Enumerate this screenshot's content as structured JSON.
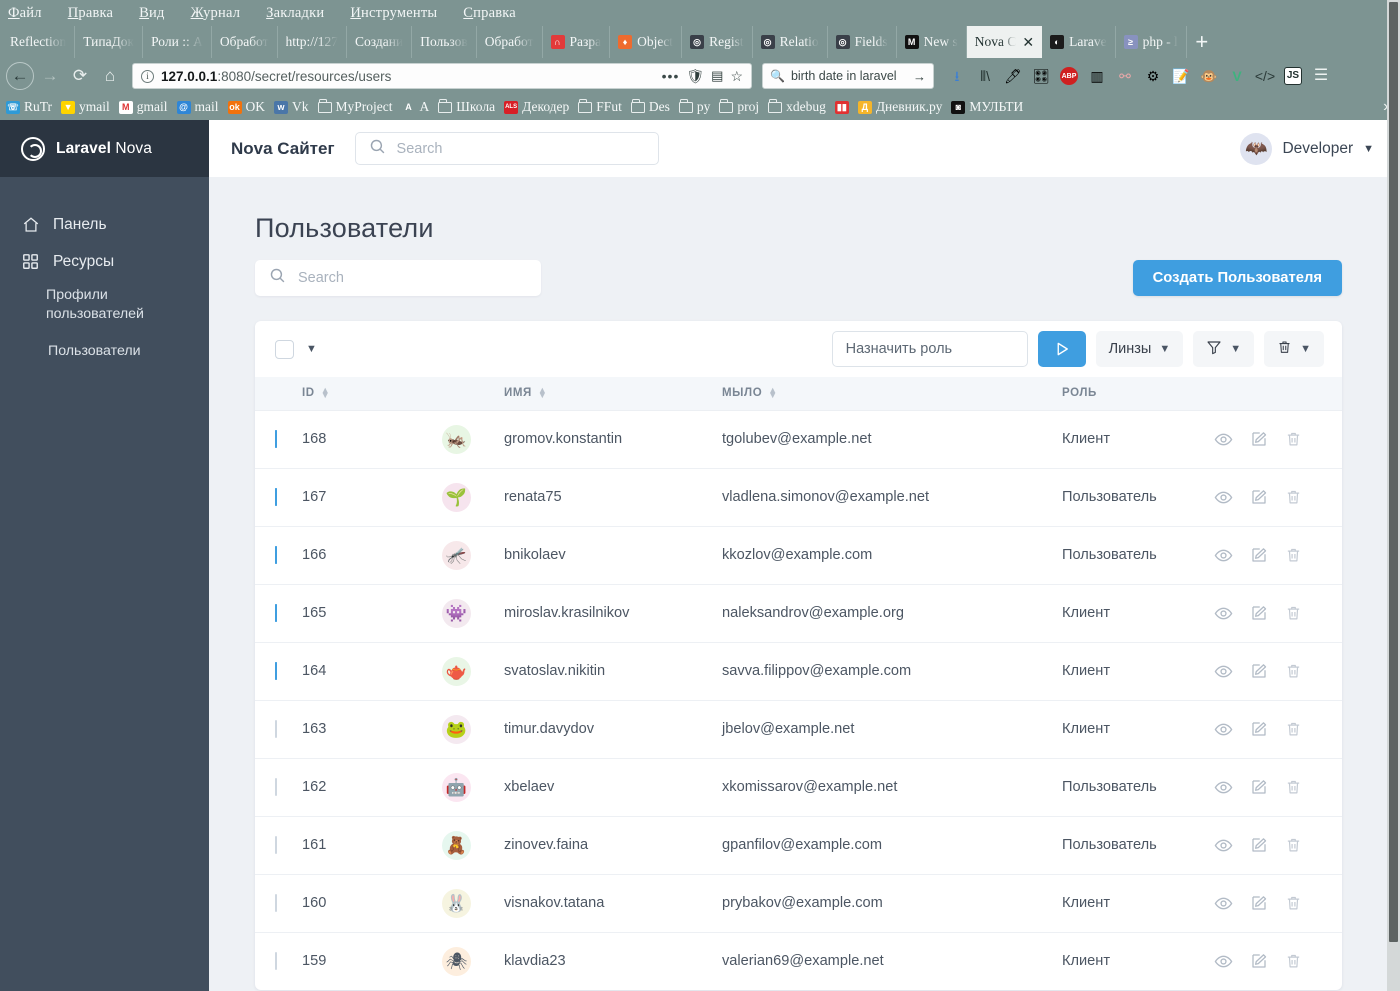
{
  "browser": {
    "menu": [
      "Файл",
      "Правка",
      "Вид",
      "Журнал",
      "Закладки",
      "Инструменты",
      "Справка"
    ],
    "tabs": [
      {
        "label": "Reflection",
        "icon": "",
        "icon_bg": "",
        "active": false
      },
      {
        "label": "ТипаДок",
        "icon": "",
        "icon_bg": "",
        "active": false
      },
      {
        "label": "Роли :: A",
        "icon": "",
        "icon_bg": "",
        "active": false
      },
      {
        "label": "Обработ",
        "icon": "",
        "icon_bg": "",
        "active": false
      },
      {
        "label": "http://127",
        "icon": "",
        "icon_bg": "",
        "active": false
      },
      {
        "label": "Создани",
        "icon": "",
        "icon_bg": "",
        "active": false
      },
      {
        "label": "Пользов",
        "icon": "",
        "icon_bg": "",
        "active": false
      },
      {
        "label": "Обработ",
        "icon": "",
        "icon_bg": "",
        "active": false
      },
      {
        "label": "Разра",
        "icon": "∩",
        "icon_bg": "#e23a3a",
        "active": false
      },
      {
        "label": "Object",
        "icon": "♦",
        "icon_bg": "#ee6b2f",
        "active": false
      },
      {
        "label": "Regist",
        "icon": "◎",
        "icon_bg": "#3a4049",
        "active": false
      },
      {
        "label": "Relatio",
        "icon": "◎",
        "icon_bg": "#3a4049",
        "active": false
      },
      {
        "label": "Fields",
        "icon": "◎",
        "icon_bg": "#3a4049",
        "active": false
      },
      {
        "label": "New s",
        "icon": "M",
        "icon_bg": "#111111",
        "active": false
      },
      {
        "label": "Nova C",
        "icon": "",
        "icon_bg": "",
        "active": true
      },
      {
        "label": "Larave",
        "icon": "◐",
        "icon_bg": "#1b1b1b",
        "active": false
      },
      {
        "label": "php - l",
        "icon": "≥",
        "icon_bg": "#8892bf",
        "active": false
      }
    ],
    "newtab_label": "+",
    "close_label": "✕",
    "url_host": "127.0.0.1",
    "url_path": ":8080/secret/resources/users",
    "search_value": "birth date in laravel",
    "toolbar_icons": [
      "download-icon",
      "library-icon",
      "eyedropper-icon",
      "extension-icon",
      "adblock-icon",
      "reader-icon",
      "graph-icon",
      "gear-icon",
      "edit-tool-icon",
      "monkey-icon",
      "vue-icon",
      "code-icon",
      "js-icon",
      "hamburger-menu-icon"
    ],
    "bookmarks": [
      {
        "label": "RuTr",
        "ico": "☏",
        "bg": "#2f9ad6",
        "type": "glyph"
      },
      {
        "label": "ymail",
        "ico": "▼",
        "bg": "#ffd400",
        "type": "glyph"
      },
      {
        "label": "gmail",
        "ico": "M",
        "bg": "#ffffff",
        "type": "glyph"
      },
      {
        "label": "mail",
        "ico": "@",
        "bg": "#2f86d6",
        "type": "glyph"
      },
      {
        "label": "OK",
        "ico": "ok",
        "bg": "#f2720c",
        "type": "glyph"
      },
      {
        "label": "Vk",
        "ico": "w",
        "bg": "#4a76a8",
        "type": "glyph"
      },
      {
        "label": "MyProject",
        "ico": "",
        "bg": "",
        "type": "folder"
      },
      {
        "label": "A",
        "ico": "A",
        "bg": "",
        "type": "glyph"
      },
      {
        "label": "Школа",
        "ico": "",
        "bg": "",
        "type": "folder"
      },
      {
        "label": "Декодер",
        "ico": "ALS",
        "bg": "#d81f26",
        "type": "glyph"
      },
      {
        "label": "FFut",
        "ico": "",
        "bg": "",
        "type": "folder"
      },
      {
        "label": "Des",
        "ico": "",
        "bg": "",
        "type": "folder"
      },
      {
        "label": "py",
        "ico": "",
        "bg": "",
        "type": "folder"
      },
      {
        "label": "proj",
        "ico": "",
        "bg": "",
        "type": "folder"
      },
      {
        "label": "xdebug",
        "ico": "",
        "bg": "",
        "type": "folder"
      },
      {
        "label": "",
        "ico": "▮▮",
        "bg": "#e03131",
        "type": "glyph"
      },
      {
        "label": "Дневник.ру",
        "ico": "Д",
        "bg": "#f5b52a",
        "type": "glyph"
      },
      {
        "label": "МУЛЬТИ",
        "ico": "◙",
        "bg": "#111111",
        "type": "glyph"
      }
    ],
    "bookmarks_overflow": "»"
  },
  "sidebar": {
    "brand_bold": "Laravel",
    "brand_light": "Nova",
    "items": [
      {
        "label": "Панель",
        "icon": "home-icon"
      },
      {
        "label": "Ресурсы",
        "icon": "grid-icon"
      }
    ],
    "subitems": [
      {
        "label": "Профили пользователей"
      },
      {
        "label": "Пользователи"
      }
    ]
  },
  "header": {
    "title": "Nova Сайтег",
    "search_placeholder": "Search",
    "user_name": "Developer",
    "user_chevron": "⌄",
    "avatar_glyph": "🦇"
  },
  "page": {
    "title": "Пользователи",
    "list_search_placeholder": "Search",
    "create_button": "Создать Пользователя"
  },
  "toolbar": {
    "select_all_chevron": "⌄",
    "assign_role_placeholder": "Назначить роль",
    "run_action_label": "▷",
    "lenses_label": "Линзы",
    "lenses_chevron": "⌄",
    "filter_chevron": "⌄",
    "trash_chevron": "⌄"
  },
  "table": {
    "columns": [
      {
        "key": "id",
        "label": "ID",
        "sortable": true
      },
      {
        "key": "name",
        "label": "имя",
        "sortable": true
      },
      {
        "key": "email",
        "label": "мыло",
        "sortable": true
      },
      {
        "key": "role",
        "label": "роль",
        "sortable": false
      }
    ],
    "rows": [
      {
        "selected": true,
        "id": "168",
        "name": "gromov.konstantin",
        "email": "tgolubev@example.net",
        "role": "Клиент",
        "avatar": "🦗",
        "avatar_bg": "#e8f6e4"
      },
      {
        "selected": true,
        "id": "167",
        "name": "renata75",
        "email": "vladlena.simonov@example.net",
        "role": "Пользователь",
        "avatar": "🌱",
        "avatar_bg": "#f6e4ee"
      },
      {
        "selected": true,
        "id": "166",
        "name": "bnikolaev",
        "email": "kkozlov@example.com",
        "role": "Пользователь",
        "avatar": "🦟",
        "avatar_bg": "#f7e8ea"
      },
      {
        "selected": true,
        "id": "165",
        "name": "miroslav.krasilnikov",
        "email": "naleksandrov@example.org",
        "role": "Клиент",
        "avatar": "👾",
        "avatar_bg": "#f3e9ef"
      },
      {
        "selected": true,
        "id": "164",
        "name": "svatoslav.nikitin",
        "email": "savva.filippov@example.com",
        "role": "Клиент",
        "avatar": "🫖",
        "avatar_bg": "#e9f6e6"
      },
      {
        "selected": false,
        "id": "163",
        "name": "timur.davydov",
        "email": "jbelov@example.net",
        "role": "Клиент",
        "avatar": "🐸",
        "avatar_bg": "#f4e9f0"
      },
      {
        "selected": false,
        "id": "162",
        "name": "xbelaev",
        "email": "xkomissarov@example.net",
        "role": "Пользователь",
        "avatar": "🤖",
        "avatar_bg": "#fbe6f1"
      },
      {
        "selected": false,
        "id": "161",
        "name": "zinovev.faina",
        "email": "gpanfilov@example.com",
        "role": "Пользователь",
        "avatar": "🧸",
        "avatar_bg": "#e6f7ef"
      },
      {
        "selected": false,
        "id": "160",
        "name": "visnakov.tatana",
        "email": "prybakov@example.com",
        "role": "Клиент",
        "avatar": "🐰",
        "avatar_bg": "#f6f4e0"
      },
      {
        "selected": false,
        "id": "159",
        "name": "klavdia23",
        "email": "valerian69@example.net",
        "role": "Клиент",
        "avatar": "🕷",
        "avatar_bg": "#fdeede"
      }
    ],
    "row_actions": [
      "view-icon",
      "edit-icon",
      "delete-icon"
    ]
  }
}
